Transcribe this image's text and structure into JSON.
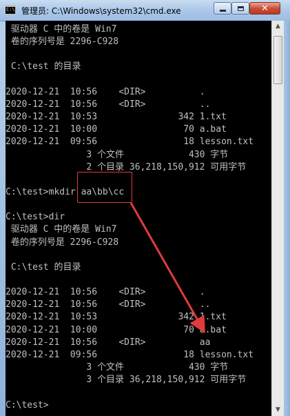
{
  "window": {
    "icon_text": "C:\\",
    "title": "管理员: C:\\Windows\\system32\\cmd.exe",
    "minimize_icon": "minimize-icon",
    "maximize_icon": "maximize-icon",
    "close_glyph": "✕"
  },
  "console": {
    "text_color": "#c0c0c0",
    "lines": [
      " 驱动器 C 中的卷是 Win7",
      " 卷的序列号是 2296-C928",
      "",
      " C:\\test 的目录",
      "",
      "2020-12-21  10:56    <DIR>          .",
      "2020-12-21  10:56    <DIR>          ..",
      "2020-12-21  10:53               342 1.txt",
      "2020-12-21  10:00                70 a.bat",
      "2020-12-21  09:56                18 lesson.txt",
      "               3 个文件            430 字节",
      "               2 个目录 36,218,150,912 可用字节",
      "",
      "C:\\test>mkdir aa\\bb\\cc",
      "",
      "C:\\test>dir",
      " 驱动器 C 中的卷是 Win7",
      " 卷的序列号是 2296-C928",
      "",
      " C:\\test 的目录",
      "",
      "2020-12-21  10:56    <DIR>          .",
      "2020-12-21  10:56    <DIR>          ..",
      "2020-12-21  10:53               342 1.txt",
      "2020-12-21  10:00                70 a.bat",
      "2020-12-21  10:56    <DIR>          aa",
      "2020-12-21  09:56                18 lesson.txt",
      "               3 个文件            430 字节",
      "               3 个目录 36,218,150,912 可用字节",
      "",
      "C:\\test>"
    ]
  },
  "annotation": {
    "color": "#e23b3b"
  },
  "scrollbar": {
    "up_arrow": "▲",
    "down_arrow": "▼"
  }
}
